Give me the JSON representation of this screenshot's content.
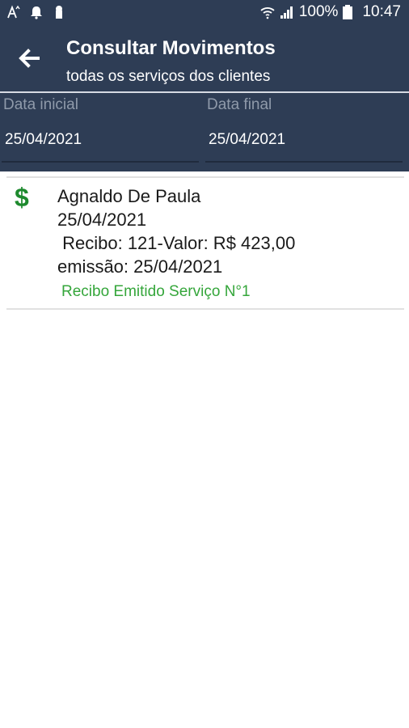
{
  "status_bar": {
    "battery": "100%",
    "time": "10:47",
    "icons": [
      "text-size-icon",
      "notification-bell-icon",
      "keyhole-icon",
      "wifi-icon",
      "signal-icon",
      "battery-icon"
    ]
  },
  "app_bar": {
    "title": "Consultar Movimentos",
    "subtitle": "todas os serviços dos clientes",
    "back_icon": "arrow-left-icon"
  },
  "filters": {
    "start_date": {
      "label": "Data inicial",
      "value": "25/04/2021"
    },
    "end_date": {
      "label": "Data final",
      "value": "25/04/2021"
    }
  },
  "movements": [
    {
      "icon_symbol": "$",
      "client": "Agnaldo De Paula",
      "date": "25/04/2021",
      "receipt": " Recibo: 121-Valor: R$ 423,00",
      "emission": "emissão: 25/04/2021",
      "note": "Recibo Emitido Serviço N°1"
    }
  ],
  "colors": {
    "header_bg": "#2e3d55",
    "accent_green": "#35a63b",
    "dollar_green": "#1e8a2e"
  }
}
